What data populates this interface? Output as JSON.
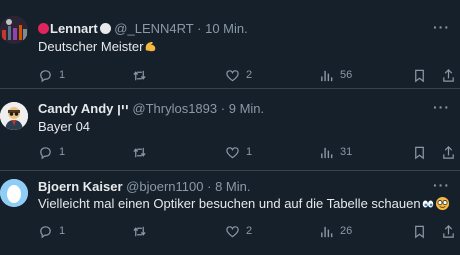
{
  "tweets": [
    {
      "name": "Lennart",
      "handle": "@_LENN4RT",
      "separator": "·",
      "time": "10 Min.",
      "text": "Deutscher Meister",
      "text_emoji": "flexed-biceps-emoji",
      "replies": "1",
      "retweets": "",
      "likes": "2",
      "views": "56"
    },
    {
      "name": "Candy Andy",
      "name_suffix": "יין",
      "handle": "@Thrylos1893",
      "separator": "·",
      "time": "9 Min.",
      "text": "Bayer 04",
      "replies": "1",
      "retweets": "",
      "likes": "1",
      "views": "31"
    },
    {
      "name": "Bjoern Kaiser",
      "handle": "@bjoern1100",
      "separator": "·",
      "time": "8 Min.",
      "text": "Vielleicht mal einen Optiker besuchen und auf die Tabelle schauen",
      "text_emoji": "eyes-and-nerd-face-emoji",
      "replies": "1",
      "retweets": "",
      "likes": "2",
      "views": "26"
    }
  ],
  "more_label": "···",
  "colors": {
    "background": "#15202b",
    "text": "#e7e9ea",
    "muted": "#8b98a5",
    "divider": "#38444d"
  }
}
